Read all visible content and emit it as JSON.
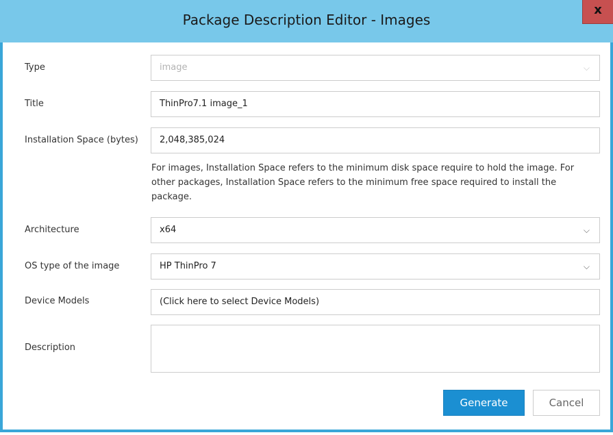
{
  "window": {
    "title": "Package Description Editor - Images",
    "close_label": "x"
  },
  "form": {
    "type": {
      "label": "Type",
      "value": "image",
      "icon": "chevron-down-icon"
    },
    "title": {
      "label": "Title",
      "value": "ThinPro7.1 image_1"
    },
    "installation_space": {
      "label": "Installation Space (bytes)",
      "value": "2,048,385,024",
      "note": "For images, Installation Space refers to the minimum disk space require to hold the image. For other packages, Installation Space refers to the minimum free space required to install the package."
    },
    "architecture": {
      "label": "Architecture",
      "value": "x64",
      "icon": "chevron-down-icon"
    },
    "os_type": {
      "label": "OS type of the image",
      "value": "HP ThinPro 7",
      "icon": "chevron-down-icon"
    },
    "device_models": {
      "label": "Device Models",
      "value": "(Click here to select Device Models)"
    },
    "description": {
      "label": "Description",
      "value": ""
    }
  },
  "buttons": {
    "generate": "Generate",
    "cancel": "Cancel"
  },
  "colors": {
    "titlebar": "#78c8ea",
    "border": "#3aa6d8",
    "close": "#c75050",
    "primary": "#1b8fd2"
  }
}
